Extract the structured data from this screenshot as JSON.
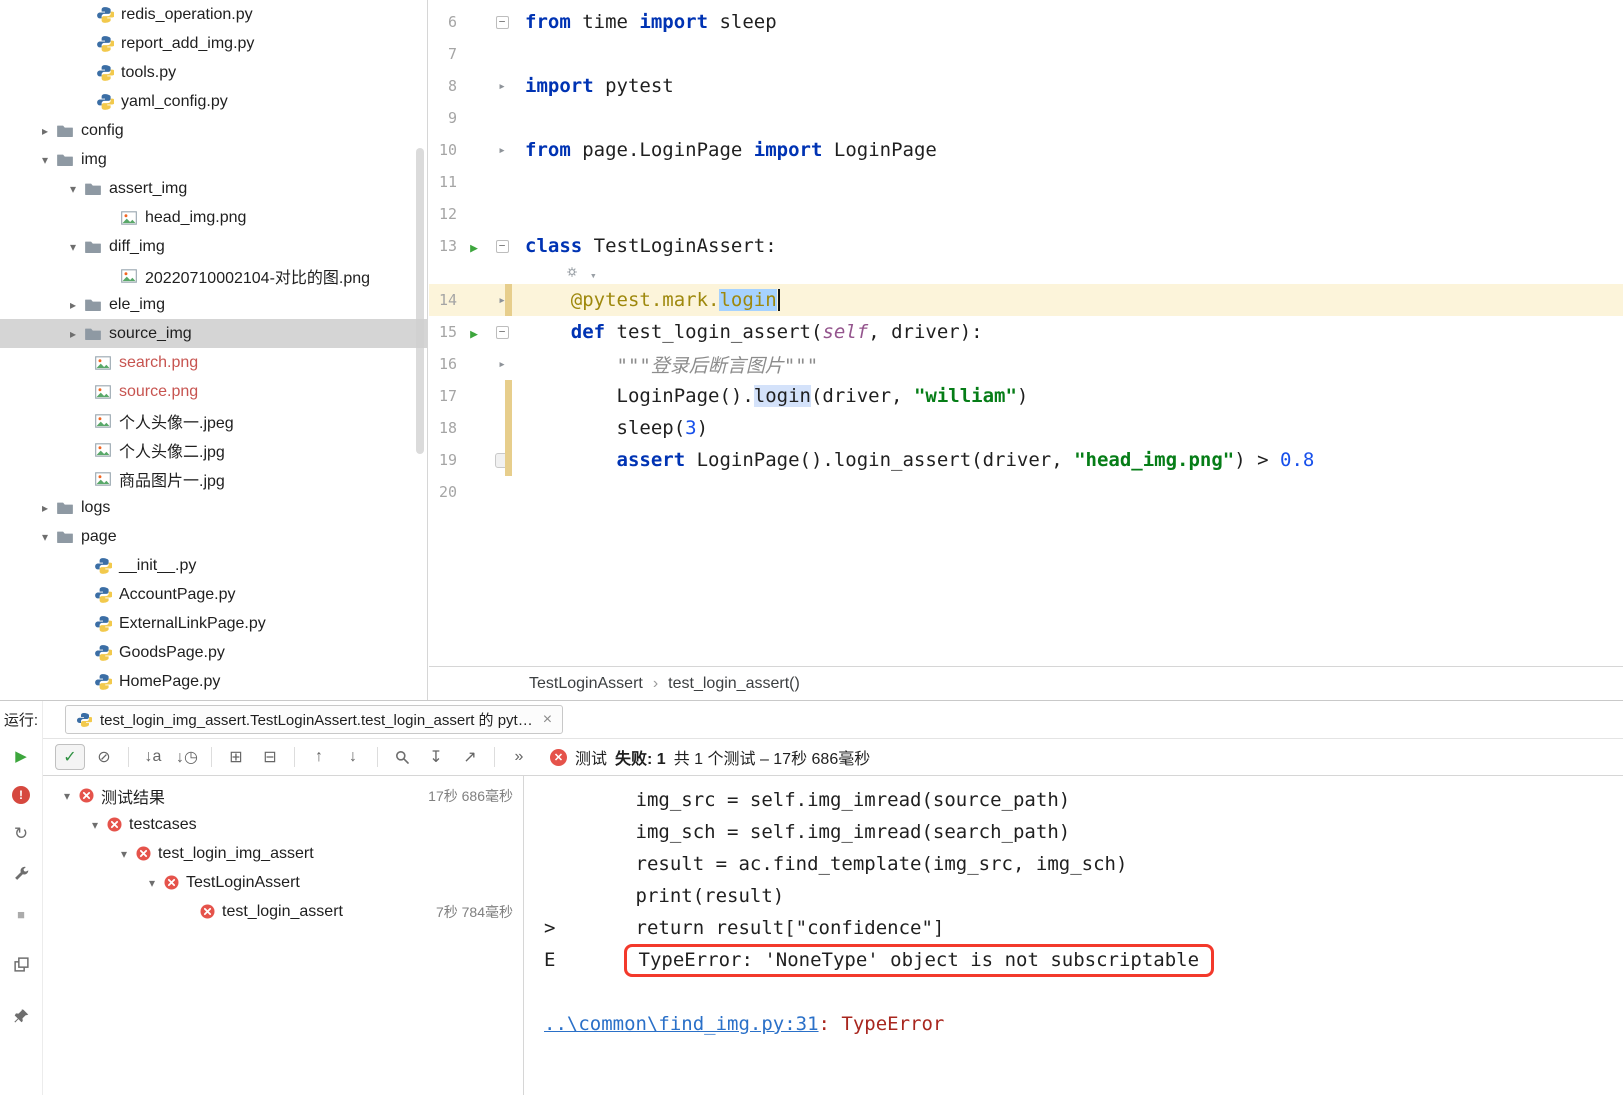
{
  "colors": {
    "keyword": "#0033B3",
    "string": "#067D17",
    "number": "#1750EB",
    "decorator": "#9E880D",
    "self_param": "#94558D",
    "docstring": "#8C8C8C",
    "caret_row": "#FCF4DA",
    "selection": "#A6D2FF",
    "identifier_highlight": "#D4E2FA",
    "tree_selection": "#D5D5D5",
    "unversioned_red": "#C75450",
    "run_green": "#3DA63D",
    "link_blue": "#2A70C8",
    "stack_error_red": "#A8261E",
    "error_box_red": "#F3392B"
  },
  "project_tree": {
    "items": [
      {
        "label": "redis_operation.py",
        "icon": "python-file-icon",
        "indent": 96
      },
      {
        "label": "report_add_img.py",
        "icon": "python-file-icon",
        "indent": 96
      },
      {
        "label": "tools.py",
        "icon": "python-file-icon",
        "indent": 96
      },
      {
        "label": "yaml_config.py",
        "icon": "python-file-icon",
        "indent": 96
      },
      {
        "label": "config",
        "icon": "folder-icon",
        "indent": 34,
        "chevron": "collapsed"
      },
      {
        "label": "img",
        "icon": "folder-icon",
        "indent": 34,
        "chevron": "expanded"
      },
      {
        "label": "assert_img",
        "icon": "folder-icon",
        "indent": 62,
        "chevron": "expanded"
      },
      {
        "label": "head_img.png",
        "icon": "image-file-icon",
        "indent": 120
      },
      {
        "label": "diff_img",
        "icon": "folder-icon",
        "indent": 62,
        "chevron": "expanded"
      },
      {
        "label": "20220710002104-对比的图.png",
        "icon": "image-file-icon",
        "indent": 120
      },
      {
        "label": "ele_img",
        "icon": "folder-icon",
        "indent": 62,
        "chevron": "collapsed"
      },
      {
        "label": "source_img",
        "icon": "folder-icon",
        "indent": 62,
        "chevron": "collapsed",
        "selected": true
      },
      {
        "label": "search.png",
        "icon": "image-file-icon",
        "indent": 94,
        "color": "red"
      },
      {
        "label": "source.png",
        "icon": "image-file-icon",
        "indent": 94,
        "color": "red"
      },
      {
        "label": "个人头像一.jpeg",
        "icon": "image-file-icon",
        "indent": 94
      },
      {
        "label": "个人头像二.jpg",
        "icon": "image-file-icon",
        "indent": 94
      },
      {
        "label": "商品图片一.jpg",
        "icon": "image-file-icon",
        "indent": 94
      },
      {
        "label": "logs",
        "icon": "folder-icon",
        "indent": 34,
        "chevron": "collapsed"
      },
      {
        "label": "page",
        "icon": "folder-icon",
        "indent": 34,
        "chevron": "expanded"
      },
      {
        "label": "__init__.py",
        "icon": "python-file-icon",
        "indent": 94
      },
      {
        "label": "AccountPage.py",
        "icon": "python-file-icon",
        "indent": 94
      },
      {
        "label": "ExternalLinkPage.py",
        "icon": "python-file-icon",
        "indent": 94
      },
      {
        "label": "GoodsPage.py",
        "icon": "python-file-icon",
        "indent": 94
      },
      {
        "label": "HomePage.py",
        "icon": "python-file-icon",
        "indent": 94
      }
    ]
  },
  "editor": {
    "lines": [
      {
        "num": "6",
        "marks": [
          "foldbox"
        ],
        "seg": [
          {
            "t": "from",
            "c": "kw"
          },
          {
            "t": " time "
          },
          {
            "t": "import",
            "c": "kw"
          },
          {
            "t": " sleep"
          }
        ]
      },
      {
        "num": "7",
        "seg": []
      },
      {
        "num": "8",
        "marks": [
          "arrow"
        ],
        "seg": [
          {
            "t": "import",
            "c": "kw"
          },
          {
            "t": " pytest"
          }
        ]
      },
      {
        "num": "9",
        "seg": []
      },
      {
        "num": "10",
        "marks": [
          "arrow"
        ],
        "seg": [
          {
            "t": "from",
            "c": "kw"
          },
          {
            "t": " page.LoginPage "
          },
          {
            "t": "import",
            "c": "kw"
          },
          {
            "t": " LoginPage"
          }
        ]
      },
      {
        "num": "11",
        "seg": []
      },
      {
        "num": "12",
        "seg": []
      },
      {
        "num": "13",
        "marks": [
          "run",
          "foldbox"
        ],
        "seg": [
          {
            "t": "class",
            "c": "kw"
          },
          {
            "t": " TestLoginAssert:"
          }
        ]
      },
      {
        "inlay": true
      },
      {
        "num": "14",
        "current": true,
        "marks": [
          "arrow"
        ],
        "seg": [
          {
            "t": "    "
          },
          {
            "t": "@pytest.mark.",
            "c": "dec"
          },
          {
            "t": "login",
            "c": "dec sel"
          },
          {
            "t": "",
            "c": "caret"
          }
        ]
      },
      {
        "num": "15",
        "marks": [
          "run",
          "foldbox"
        ],
        "seg": [
          {
            "t": "    "
          },
          {
            "t": "def",
            "c": "kw"
          },
          {
            "t": " test_login_assert("
          },
          {
            "t": "self",
            "c": "self"
          },
          {
            "t": ", driver):"
          }
        ]
      },
      {
        "num": "16",
        "marks": [
          "arrow"
        ],
        "seg": [
          {
            "t": "        "
          },
          {
            "t": "\"\"\"登录后断言图片\"\"\"",
            "c": "doc"
          }
        ]
      },
      {
        "num": "17",
        "seg": [
          {
            "t": "        LoginPage()."
          },
          {
            "t": "login",
            "c": "hl"
          },
          {
            "t": "(driver, "
          },
          {
            "t": "\"william\"",
            "c": "str"
          },
          {
            "t": ")"
          }
        ]
      },
      {
        "num": "18",
        "seg": [
          {
            "t": "        sleep("
          },
          {
            "t": "3",
            "c": "num"
          },
          {
            "t": ")"
          }
        ]
      },
      {
        "num": "19",
        "marks": [
          "gicon"
        ],
        "seg": [
          {
            "t": "        "
          },
          {
            "t": "assert",
            "c": "kw"
          },
          {
            "t": " LoginPage().login_assert(driver, "
          },
          {
            "t": "\"head_img.png\"",
            "c": "str"
          },
          {
            "t": ") > "
          },
          {
            "t": "0.8",
            "c": "num"
          }
        ]
      },
      {
        "num": "20",
        "seg": []
      }
    ],
    "breadcrumb": {
      "items": [
        "TestLoginAssert",
        "test_login_assert()"
      ],
      "separator": "›"
    }
  },
  "run_panel": {
    "label": "运行:",
    "tab": {
      "icon": "python-run-icon",
      "title": "test_login_img_assert.TestLoginAssert.test_login_assert 的 pyt…",
      "close": "×"
    },
    "toolbar": {
      "icons": [
        {
          "name": "show-passed-toggle",
          "glyph": "✓",
          "cls": "boxed green"
        },
        {
          "name": "show-ignored-toggle",
          "glyph": "⊘"
        },
        {
          "name": "separator"
        },
        {
          "name": "sort-alphabetically-button",
          "glyph": "↓a"
        },
        {
          "name": "sort-by-duration-button",
          "glyph": "↓◷"
        },
        {
          "name": "separator"
        },
        {
          "name": "expand-all-button",
          "glyph": "⊞"
        },
        {
          "name": "collapse-all-button",
          "glyph": "⊟"
        },
        {
          "name": "separator"
        },
        {
          "name": "previous-failed-test-button",
          "glyph": "↑"
        },
        {
          "name": "next-failed-test-button",
          "glyph": "↓"
        },
        {
          "name": "separator"
        },
        {
          "name": "magnifier-button",
          "glyph": "svg:magnifier"
        },
        {
          "name": "import-test-results-button",
          "glyph": "↧"
        },
        {
          "name": "export-test-results-button",
          "glyph": "↗"
        },
        {
          "name": "separator"
        },
        {
          "name": "more-actions-button",
          "glyph": "»"
        }
      ]
    },
    "status": {
      "icon": "test-failed-icon",
      "segments": [
        "测试 ",
        "失败: 1",
        "共 1 个测试 – 17秒 686毫秒"
      ]
    },
    "stripe": {
      "icons": [
        {
          "name": "rerun-tests-button",
          "glyph": "▶"
        },
        {
          "name": "rerun-failed-tests-button",
          "glyph": "!",
          "cls": "redcircle"
        },
        {
          "name": "toggle-auto-test-button",
          "glyph": "↻"
        },
        {
          "name": "settings-wrench-button",
          "glyph": "svg:wrench"
        },
        {
          "name": "stop-button",
          "glyph": "■",
          "cls": "grey"
        },
        {
          "name": "restore-layout-button",
          "glyph": "svg:layout"
        },
        {
          "name": "pin-tab-button",
          "glyph": "svg:pin"
        }
      ]
    },
    "test_tree": {
      "items": [
        {
          "label": "测试结果",
          "icon": "test-failed-icon",
          "indent": 13,
          "chevron": "expanded",
          "duration": "17秒 686毫秒"
        },
        {
          "label": "testcases",
          "icon": "test-failed-icon",
          "indent": 41,
          "chevron": "expanded"
        },
        {
          "label": "test_login_img_assert",
          "icon": "test-failed-icon",
          "indent": 70,
          "chevron": "expanded"
        },
        {
          "label": "TestLoginAssert",
          "icon": "test-failed-icon",
          "indent": 98,
          "chevron": "expanded"
        },
        {
          "label": "test_login_assert",
          "icon": "test-failed-icon",
          "indent": 156,
          "duration": "7秒 784毫秒"
        }
      ]
    },
    "console": {
      "lines": [
        {
          "seg": [
            {
              "t": "        img_src = self.img_imread(source_path)"
            }
          ]
        },
        {
          "seg": [
            {
              "t": "        img_sch = self.img_imread(search_path)"
            }
          ]
        },
        {
          "seg": [
            {
              "t": "        result = ac.find_template(img_src, img_sch)"
            }
          ]
        },
        {
          "seg": [
            {
              "t": "        print(result)"
            }
          ]
        },
        {
          "seg": [
            {
              "t": ">       return result[\"confidence\"]"
            }
          ]
        },
        {
          "seg": [
            {
              "t": "E       "
            },
            {
              "t": "TypeError: 'NoneType' object is not subscriptable",
              "c": "boxed"
            }
          ]
        },
        {
          "seg": []
        },
        {
          "seg": [
            {
              "t": "..\\common\\find_img.py:31",
              "c": "link"
            },
            {
              "t": ": TypeError",
              "c": "errname"
            }
          ]
        }
      ]
    }
  }
}
